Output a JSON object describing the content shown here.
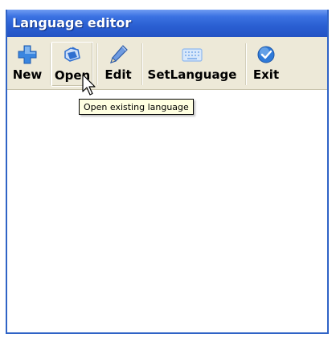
{
  "window": {
    "title": "Language editor"
  },
  "toolbar": {
    "buttons": [
      {
        "label": "New",
        "icon": "plus-icon",
        "color": "#3a86e0"
      },
      {
        "label": "Open",
        "icon": "folder-open-icon",
        "color": "#2f6fd0"
      },
      {
        "label": "Edit",
        "icon": "pencil-icon",
        "color": "#3e72c4"
      },
      {
        "label": "SetLanguage",
        "icon": "keyboard-icon",
        "color": "#8fb8ee"
      },
      {
        "label": "Exit",
        "icon": "check-circle-icon",
        "color": "#2f7ad8"
      }
    ]
  },
  "tooltip": {
    "text": "Open existing language"
  }
}
